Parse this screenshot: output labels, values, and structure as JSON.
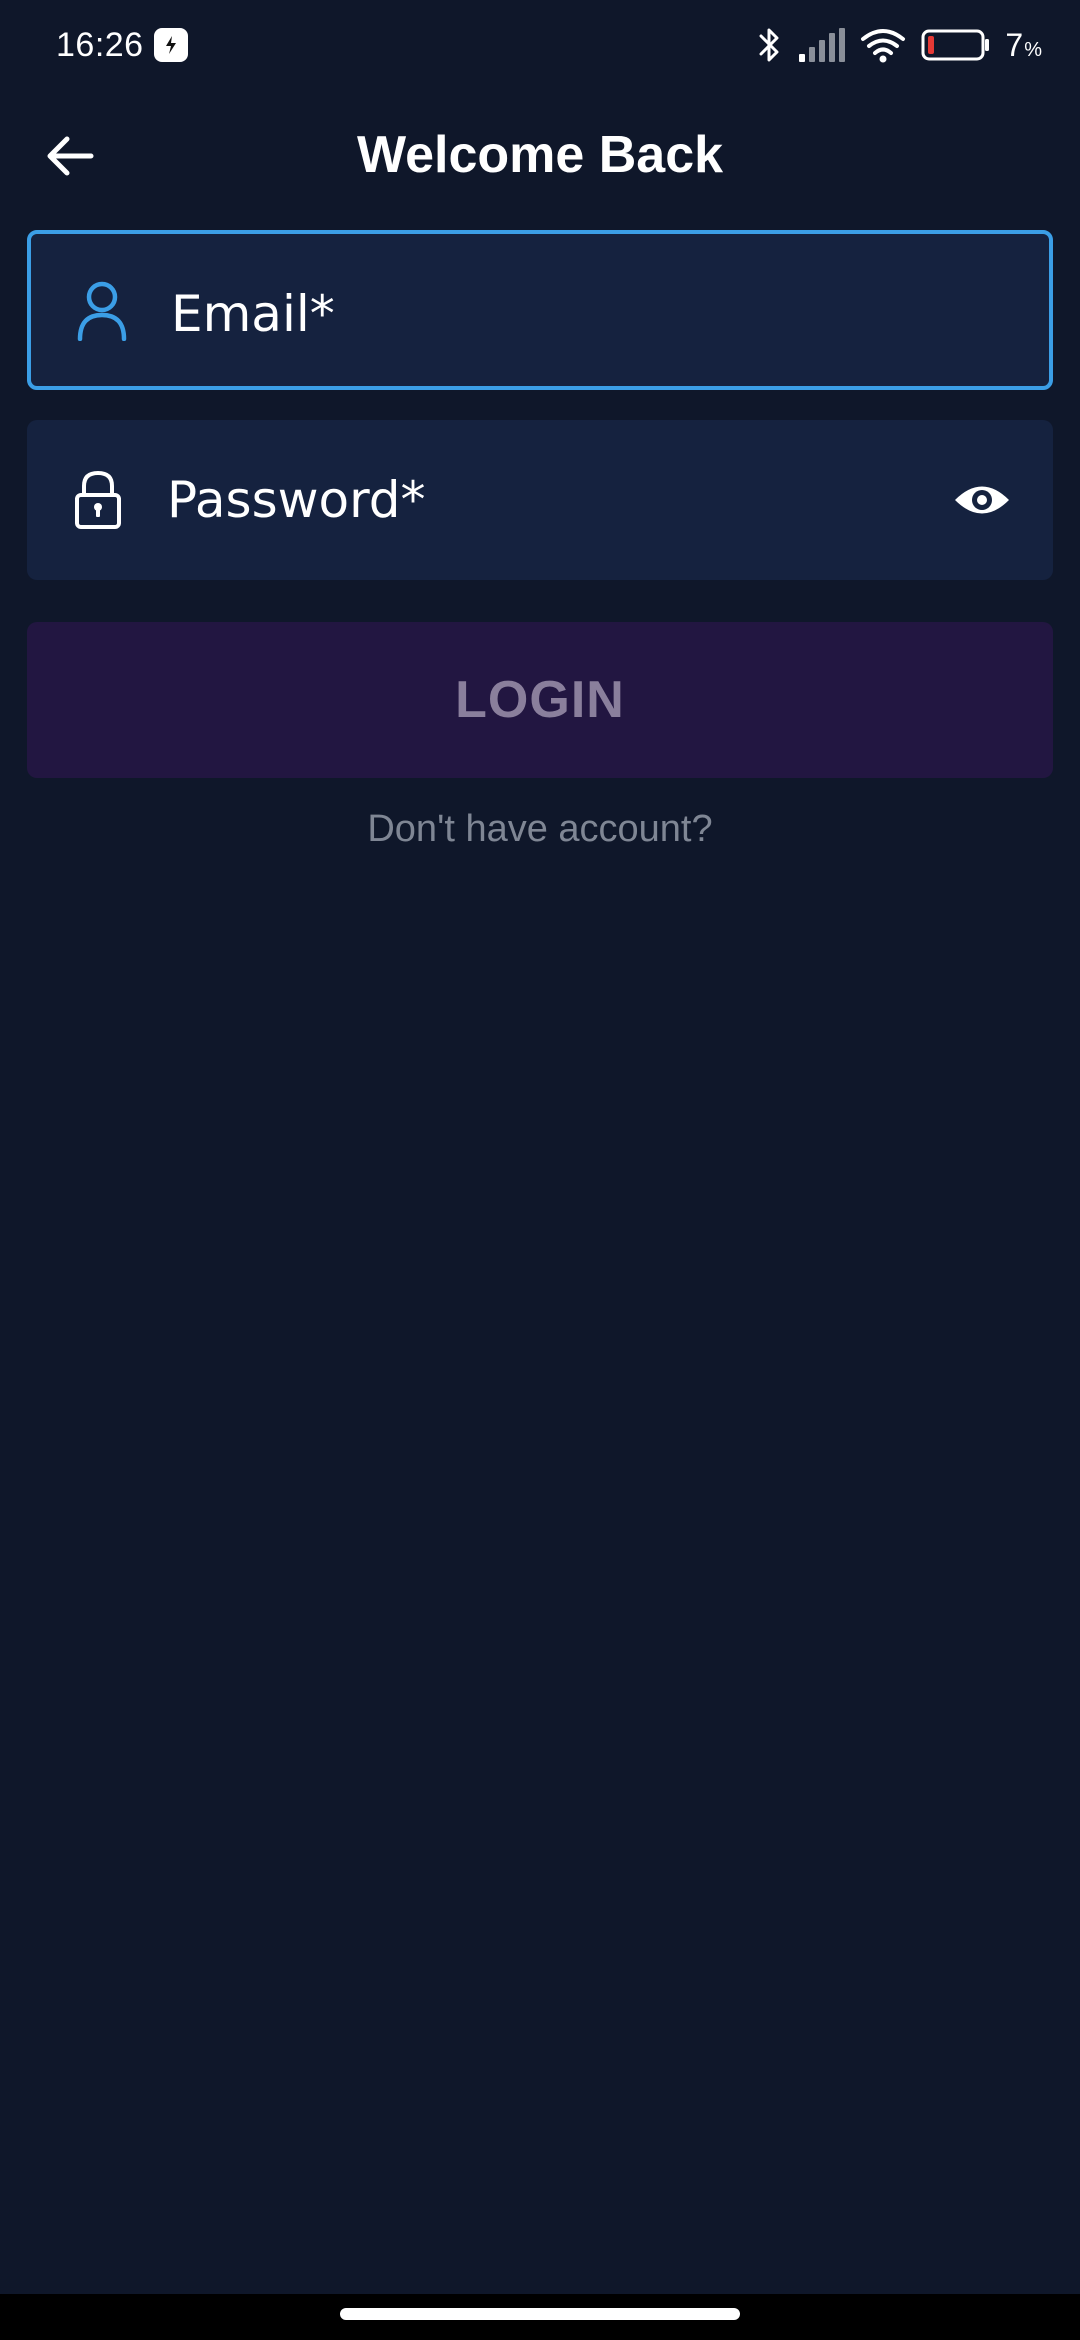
{
  "status_bar": {
    "time": "16:26",
    "battery_number": "7",
    "battery_unit": "%",
    "battery_level": 0.07,
    "icons": [
      "app-notification-icon",
      "bluetooth-icon",
      "signal-icon",
      "wifi-icon",
      "battery-icon"
    ]
  },
  "header": {
    "title": "Welcome Back",
    "back_icon": "arrow-left-icon"
  },
  "form": {
    "email": {
      "placeholder": "Email*",
      "value": "",
      "icon": "user-icon",
      "focused": true
    },
    "password": {
      "placeholder": "Password*",
      "value": "",
      "icon": "lock-icon",
      "toggle_icon": "eye-icon"
    },
    "login_label": "LOGIN",
    "signup_prompt": "Don't have account?"
  },
  "colors": {
    "background": "#0f172a",
    "field_background": "#15223f",
    "focus_accent": "#3b9ee6",
    "button_background": "#221641",
    "button_text": "#8a7f9c",
    "muted_text": "#7f8694",
    "battery_low": "#e53935"
  }
}
